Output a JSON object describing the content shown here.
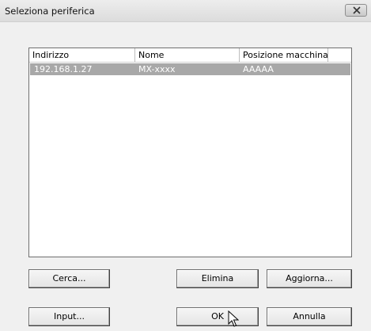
{
  "window": {
    "title": "Seleziona periferica"
  },
  "list": {
    "columns": [
      "Indirizzo",
      "Nome",
      "Posizione macchina"
    ],
    "rows": [
      {
        "address": "192.168.1.27",
        "name": "MX-xxxx",
        "location": "AAAAA",
        "selected": true
      }
    ]
  },
  "buttons": {
    "cerca": "Cerca...",
    "elimina": "Elimina",
    "aggiorna": "Aggiorna...",
    "input": "Input...",
    "ok": "OK",
    "annulla": "Annulla"
  },
  "icons": {
    "close": "close-icon",
    "cursor": "mouse-pointer-icon"
  },
  "colors": {
    "selection": "#a8a8a8",
    "dialog_bg": "#f0f0f0"
  }
}
